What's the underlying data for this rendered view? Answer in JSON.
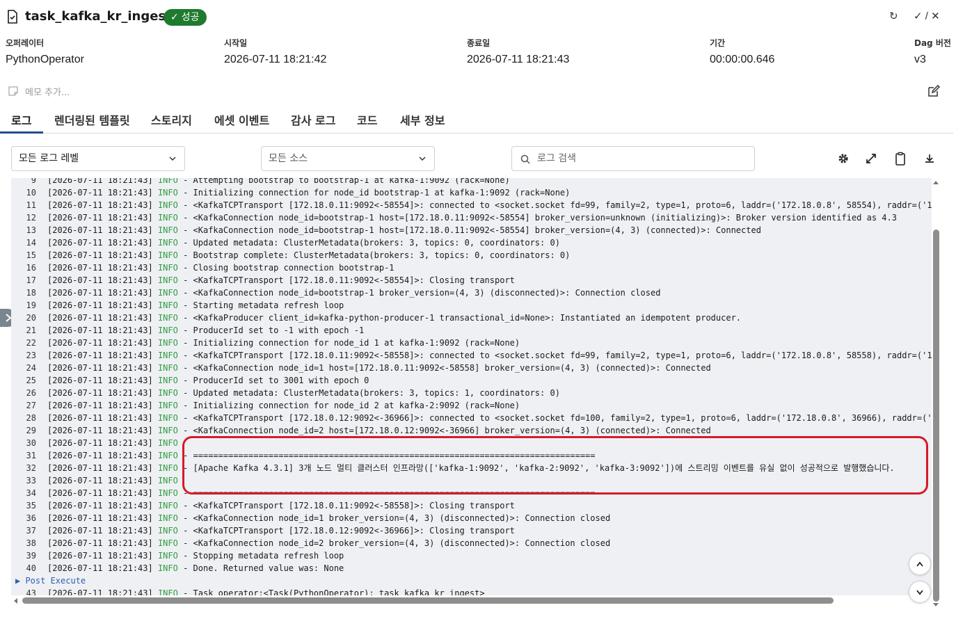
{
  "header": {
    "title": "task_kafka_kr_ingest",
    "status": "성공",
    "check_mark": "✓",
    "refresh_glyph": "↻",
    "mark_glyph": "✓ / ✕"
  },
  "meta": [
    {
      "label": "오퍼레이터",
      "value": "PythonOperator"
    },
    {
      "label": "시작일",
      "value": "2026-07-11 18:21:42"
    },
    {
      "label": "종료일",
      "value": "2026-07-11 18:21:43"
    },
    {
      "label": "기간",
      "value": "00:00:00.646"
    },
    {
      "label": "Dag 버전",
      "value": "v3"
    }
  ],
  "memo": {
    "placeholder": "메모 추가..."
  },
  "tabs": [
    {
      "label": "로그",
      "active": true
    },
    {
      "label": "렌더링된 템플릿"
    },
    {
      "label": "스토리지"
    },
    {
      "label": "에셋 이벤트"
    },
    {
      "label": "감사 로그"
    },
    {
      "label": "코드"
    },
    {
      "label": "세부 정보"
    }
  ],
  "toolbar": {
    "level_select": "모든 로그 레벨",
    "source_select": "모든 소스",
    "search_placeholder": "로그 검색"
  },
  "log": {
    "partial_first": {
      "num": "9",
      "ts": "[2026-07-11 18:21:43]",
      "level": "INFO",
      "msg": " - Attempting bootstrap to bootstrap-1 at kafka-1:9092 (rack=None)"
    },
    "lines": [
      {
        "num": "10",
        "ts": "[2026-07-11 18:21:43]",
        "level": "INFO",
        "msg": " - Initializing connection for node_id bootstrap-1 at kafka-1:9092 (rack=None)"
      },
      {
        "num": "11",
        "ts": "[2026-07-11 18:21:43]",
        "level": "INFO",
        "msg": " - <KafkaTCPTransport [172.18.0.11:9092<-58554]>: connected to <socket.socket fd=99, family=2, type=1, proto=6, laddr=('172.18.0.8', 58554), raddr=('17"
      },
      {
        "num": "12",
        "ts": "[2026-07-11 18:21:43]",
        "level": "INFO",
        "msg": " - <KafkaConnection node_id=bootstrap-1 host=[172.18.0.11:9092<-58554] broker_version=unknown (initializing)>: Broker version identified as 4.3"
      },
      {
        "num": "13",
        "ts": "[2026-07-11 18:21:43]",
        "level": "INFO",
        "msg": " - <KafkaConnection node_id=bootstrap-1 host=[172.18.0.11:9092<-58554] broker_version=(4, 3) (connected)>: Connected"
      },
      {
        "num": "14",
        "ts": "[2026-07-11 18:21:43]",
        "level": "INFO",
        "msg": " - Updated metadata: ClusterMetadata(brokers: 3, topics: 0, coordinators: 0)"
      },
      {
        "num": "15",
        "ts": "[2026-07-11 18:21:43]",
        "level": "INFO",
        "msg": " - Bootstrap complete: ClusterMetadata(brokers: 3, topics: 0, coordinators: 0)"
      },
      {
        "num": "16",
        "ts": "[2026-07-11 18:21:43]",
        "level": "INFO",
        "msg": " - Closing bootstrap connection bootstrap-1"
      },
      {
        "num": "17",
        "ts": "[2026-07-11 18:21:43]",
        "level": "INFO",
        "msg": " - <KafkaTCPTransport [172.18.0.11:9092<-58554]>: Closing transport"
      },
      {
        "num": "18",
        "ts": "[2026-07-11 18:21:43]",
        "level": "INFO",
        "msg": " - <KafkaConnection node_id=bootstrap-1 broker_version=(4, 3) (disconnected)>: Connection closed"
      },
      {
        "num": "19",
        "ts": "[2026-07-11 18:21:43]",
        "level": "INFO",
        "msg": " - Starting metadata refresh loop"
      },
      {
        "num": "20",
        "ts": "[2026-07-11 18:21:43]",
        "level": "INFO",
        "msg": " - <KafkaProducer client_id=kafka-python-producer-1 transactional_id=None>: Instantiated an idempotent producer."
      },
      {
        "num": "21",
        "ts": "[2026-07-11 18:21:43]",
        "level": "INFO",
        "msg": " - ProducerId set to -1 with epoch -1"
      },
      {
        "num": "22",
        "ts": "[2026-07-11 18:21:43]",
        "level": "INFO",
        "msg": " - Initializing connection for node_id 1 at kafka-1:9092 (rack=None)"
      },
      {
        "num": "23",
        "ts": "[2026-07-11 18:21:43]",
        "level": "INFO",
        "msg": " - <KafkaTCPTransport [172.18.0.11:9092<-58558]>: connected to <socket.socket fd=99, family=2, type=1, proto=6, laddr=('172.18.0.8', 58558), raddr=('17"
      },
      {
        "num": "24",
        "ts": "[2026-07-11 18:21:43]",
        "level": "INFO",
        "msg": " - <KafkaConnection node_id=1 host=[172.18.0.11:9092<-58558] broker_version=(4, 3) (connected)>: Connected"
      },
      {
        "num": "25",
        "ts": "[2026-07-11 18:21:43]",
        "level": "INFO",
        "msg": " - ProducerId set to 3001 with epoch 0"
      },
      {
        "num": "26",
        "ts": "[2026-07-11 18:21:43]",
        "level": "INFO",
        "msg": " - Updated metadata: ClusterMetadata(brokers: 3, topics: 1, coordinators: 0)"
      },
      {
        "num": "27",
        "ts": "[2026-07-11 18:21:43]",
        "level": "INFO",
        "msg": " - Initializing connection for node_id 2 at kafka-2:9092 (rack=None)"
      },
      {
        "num": "28",
        "ts": "[2026-07-11 18:21:43]",
        "level": "INFO",
        "msg": " - <KafkaTCPTransport [172.18.0.12:9092<-36966]>: connected to <socket.socket fd=100, family=2, type=1, proto=6, laddr=('172.18.0.8', 36966), raddr=('1"
      },
      {
        "num": "29",
        "ts": "[2026-07-11 18:21:43]",
        "level": "INFO",
        "msg": " - <KafkaConnection node_id=2 host=[172.18.0.12:9092<-36966] broker_version=(4, 3) (connected)>: Connected"
      },
      {
        "num": "30",
        "ts": "[2026-07-11 18:21:43]",
        "level": "INFO",
        "msg": ""
      },
      {
        "num": "31",
        "ts": "[2026-07-11 18:21:43]",
        "level": "INFO",
        "msg": " - ================================================================================"
      },
      {
        "num": "32",
        "ts": "[2026-07-11 18:21:43]",
        "level": "INFO",
        "msg": " - [Apache Kafka 4.3.1] 3개 노드 멀티 클러스터 인프라망(['kafka-1:9092', 'kafka-2:9092', 'kafka-3:9092'])에 스트리밍 이벤트를 유실 없이 성공적으로 발행했습니다."
      },
      {
        "num": "33",
        "ts": "[2026-07-11 18:21:43]",
        "level": "INFO",
        "msg": ""
      },
      {
        "num": "34",
        "ts": "[2026-07-11 18:21:43]",
        "level": "INFO",
        "msg": " - ================================================================================"
      },
      {
        "num": "35",
        "ts": "[2026-07-11 18:21:43]",
        "level": "INFO",
        "msg": " - <KafkaTCPTransport [172.18.0.11:9092<-58558]>: Closing transport"
      },
      {
        "num": "36",
        "ts": "[2026-07-11 18:21:43]",
        "level": "INFO",
        "msg": " - <KafkaConnection node_id=1 broker_version=(4, 3) (disconnected)>: Connection closed"
      },
      {
        "num": "37",
        "ts": "[2026-07-11 18:21:43]",
        "level": "INFO",
        "msg": " - <KafkaTCPTransport [172.18.0.12:9092<-36966]>: Closing transport"
      },
      {
        "num": "38",
        "ts": "[2026-07-11 18:21:43]",
        "level": "INFO",
        "msg": " - <KafkaConnection node_id=2 broker_version=(4, 3) (disconnected)>: Connection closed"
      },
      {
        "num": "39",
        "ts": "[2026-07-11 18:21:43]",
        "level": "INFO",
        "msg": " - Stopping metadata refresh loop"
      },
      {
        "num": "40",
        "ts": "[2026-07-11 18:21:43]",
        "level": "INFO",
        "msg": " - Done. Returned value was: None"
      }
    ],
    "group_label": "▶ Post Execute",
    "last_line": {
      "num": "43",
      "ts": "[2026-07-11 18:21:43]",
      "level": "INFO",
      "msg": " - Task operator:<Task(PythonOperator): task_kafka_kr_ingest>"
    }
  },
  "colors": {
    "success": "#1f7a2e",
    "info_level": "#2f9e44",
    "highlight_border": "#d61a2a",
    "tab_underline": "#1f4f8a"
  }
}
